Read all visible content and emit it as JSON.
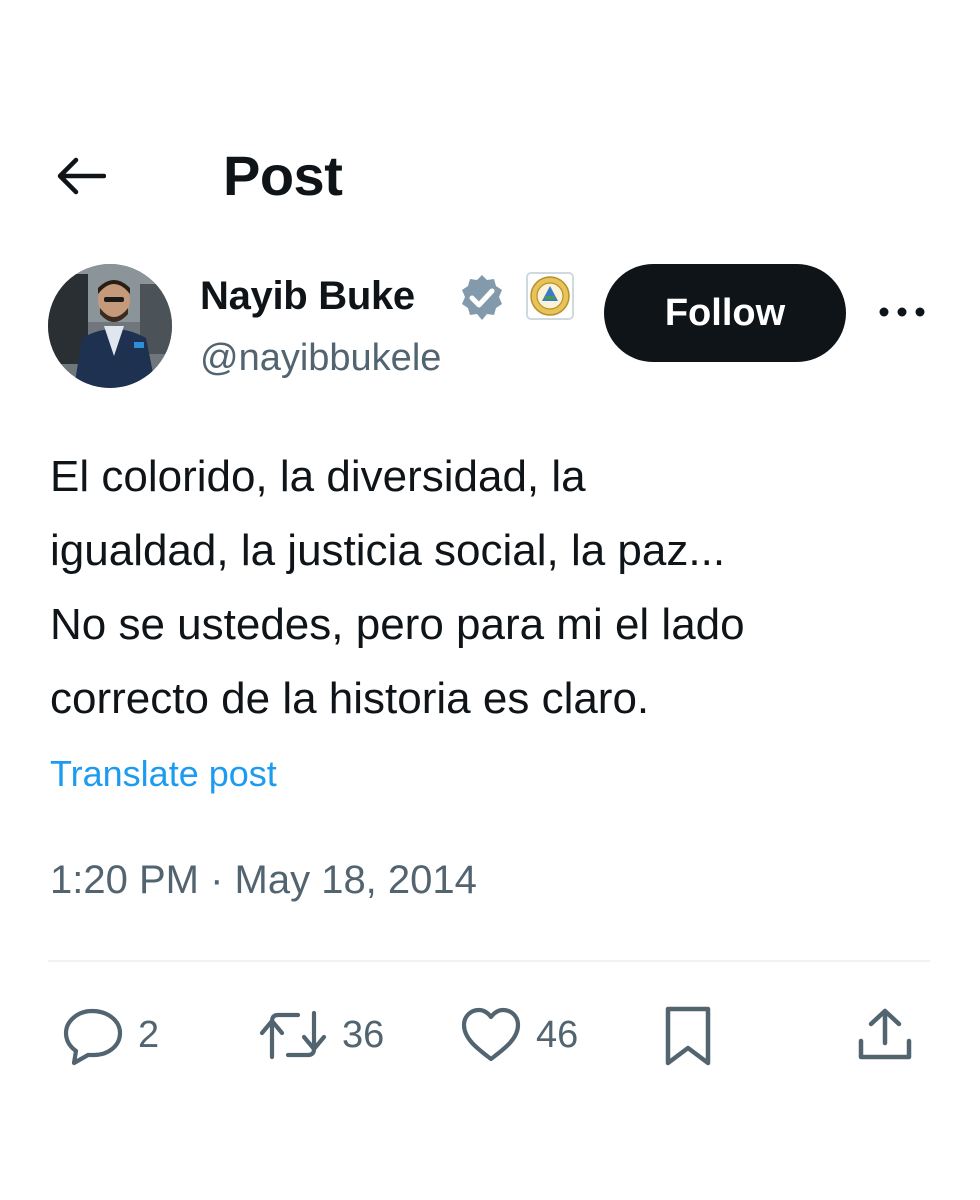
{
  "header": {
    "title": "Post",
    "back_icon": "arrow-left-icon"
  },
  "author": {
    "display_name": "Nayib Buke",
    "handle": "@nayibbukele",
    "verified_icon": "verified-badge-icon",
    "affiliate_icon": "government-seal-icon",
    "follow_label": "Follow",
    "more_icon": "more-horizontal-icon"
  },
  "post": {
    "text": "El colorido, la diversidad, la\nigualdad, la justicia social, la paz...\nNo se ustedes, pero para mi el lado\ncorrecto de la historia es claro.",
    "translate_label": "Translate post",
    "timestamp": "1:20 PM · May 18, 2014"
  },
  "actions": {
    "replies": "2",
    "reposts": "36",
    "likes": "46"
  },
  "colors": {
    "text": "#0f1419",
    "secondary": "#536471",
    "link": "#1d9bf0",
    "verified": "#829aab",
    "divider": "#eff3f4"
  }
}
